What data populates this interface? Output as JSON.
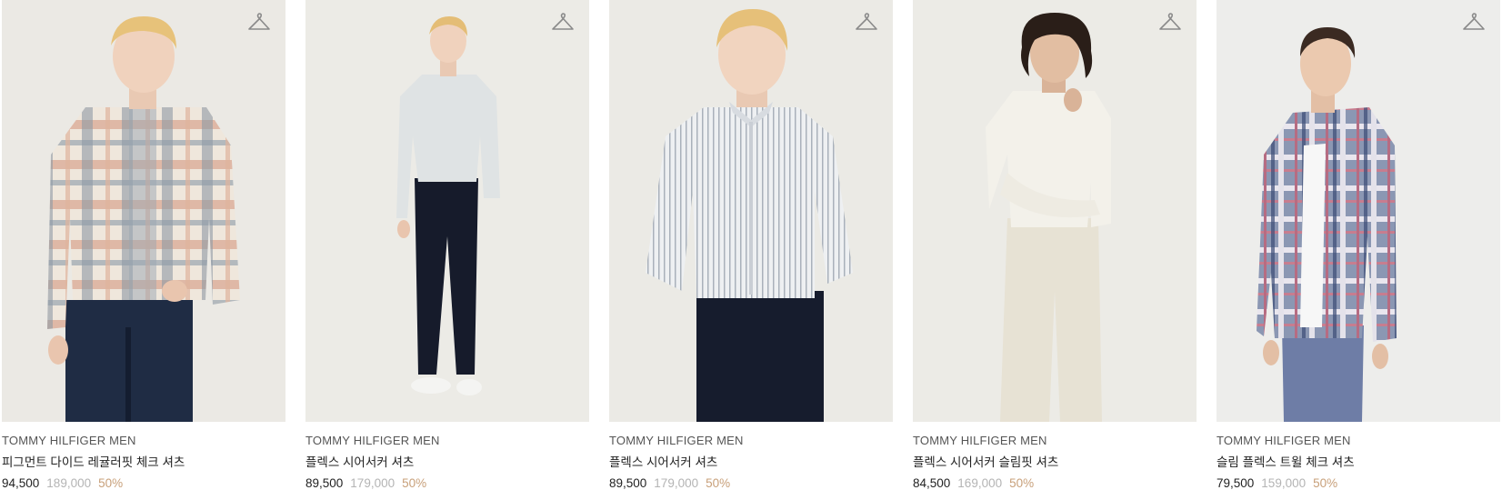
{
  "colors": {
    "sale_price": "#222222",
    "original_price": "#b4b4b4",
    "discount": "#c8a07a",
    "brand": "#555555"
  },
  "products": [
    {
      "brand": "TOMMY HILFIGER MEN",
      "name": "피그먼트 다이드 레귤러핏 체크 셔츠",
      "sale_price": "94,500",
      "original_price": "189,000",
      "discount": "50%",
      "wishlist_icon": "hanger-icon"
    },
    {
      "brand": "TOMMY HILFIGER MEN",
      "name": "플렉스 시어서커 셔츠",
      "sale_price": "89,500",
      "original_price": "179,000",
      "discount": "50%",
      "wishlist_icon": "hanger-icon"
    },
    {
      "brand": "TOMMY HILFIGER MEN",
      "name": "플렉스 시어서커 셔츠",
      "sale_price": "89,500",
      "original_price": "179,000",
      "discount": "50%",
      "wishlist_icon": "hanger-icon"
    },
    {
      "brand": "TOMMY HILFIGER MEN",
      "name": "플렉스 시어서커 슬림핏 셔츠",
      "sale_price": "84,500",
      "original_price": "169,000",
      "discount": "50%",
      "wishlist_icon": "hanger-icon"
    },
    {
      "brand": "TOMMY HILFIGER MEN",
      "name": "슬림 플렉스 트윌 체크 셔츠",
      "sale_price": "79,500",
      "original_price": "159,000",
      "discount": "50%",
      "wishlist_icon": "hanger-icon"
    }
  ]
}
